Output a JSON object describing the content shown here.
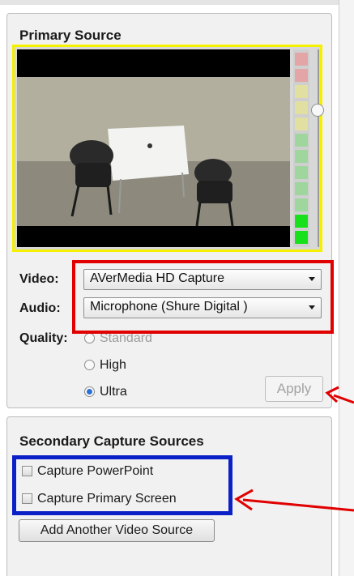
{
  "primary": {
    "heading": "Primary Source",
    "video_label": "Video:",
    "video_value": "AVerMedia HD Capture",
    "audio_label": "Audio:",
    "audio_value": "Microphone (Shure Digital   )",
    "quality_label": "Quality:",
    "quality_options": [
      {
        "label": "Standard",
        "selected": false
      },
      {
        "label": "High",
        "selected": false
      },
      {
        "label": "Ultra",
        "selected": true
      }
    ],
    "apply_label": "Apply",
    "audio_level": 0.15
  },
  "secondary": {
    "heading": "Secondary Capture Sources",
    "capture_powerpoint": "Capture PowerPoint",
    "capture_primary_screen": "Capture Primary Screen",
    "add_video_source": "Add Another Video Source"
  },
  "colors": {
    "preview_highlight": "#f5f000",
    "device_highlight": "#e10000",
    "secondary_highlight": "#0b21c7",
    "arrow": "#e10000",
    "radio_selected": "#2c6fd6"
  }
}
